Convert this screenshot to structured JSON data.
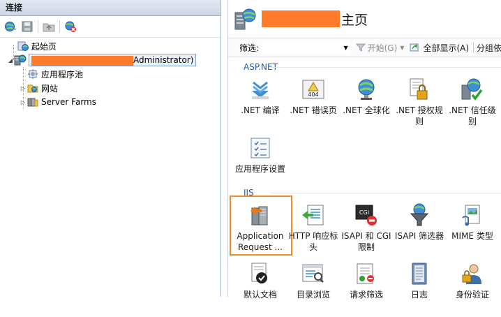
{
  "left": {
    "header": "连接",
    "tree": {
      "start_page": "起始页",
      "server_suffix": "Administrator)",
      "app_pools": "应用程序池",
      "sites": "网站",
      "server_farms": "Server Farms"
    }
  },
  "right": {
    "title_suffix": "主页",
    "filter": {
      "label": "筛选:",
      "start": "开始(G)",
      "show_all": "全部显示(A)",
      "group_by": "分组依"
    },
    "groups": [
      {
        "name": "ASP.NET",
        "features": [
          {
            "label": ".NET 编译",
            "icon": "download-arrow-icon"
          },
          {
            "label": ".NET 错误页",
            "icon": "error-404-icon"
          },
          {
            "label": ".NET 全球化",
            "icon": "globe-icon"
          },
          {
            "label": ".NET 授权规则",
            "icon": "lock-document-icon"
          },
          {
            "label": ".NET 信任级别",
            "icon": "trust-check-icon"
          },
          {
            "label": "应用程序设置",
            "icon": "settings-list-icon"
          }
        ]
      },
      {
        "name": "IIS",
        "features": [
          {
            "label": "Application Request ...",
            "icon": "server-arrow-icon"
          },
          {
            "label": "HTTP 响应标头",
            "icon": "header-list-icon"
          },
          {
            "label": "ISAPI 和 CGI 限制",
            "icon": "cgi-icon"
          },
          {
            "label": "ISAPI 筛选器",
            "icon": "funnel-icon"
          },
          {
            "label": "MIME 类型",
            "icon": "mime-icon"
          },
          {
            "label": "默认文档",
            "icon": "default-document-icon"
          },
          {
            "label": "目录浏览",
            "icon": "directory-browse-icon"
          },
          {
            "label": "请求筛选",
            "icon": "request-filter-icon"
          },
          {
            "label": "日志",
            "icon": "log-icon"
          },
          {
            "label": "身份验证",
            "icon": "authentication-icon"
          }
        ]
      }
    ]
  }
}
